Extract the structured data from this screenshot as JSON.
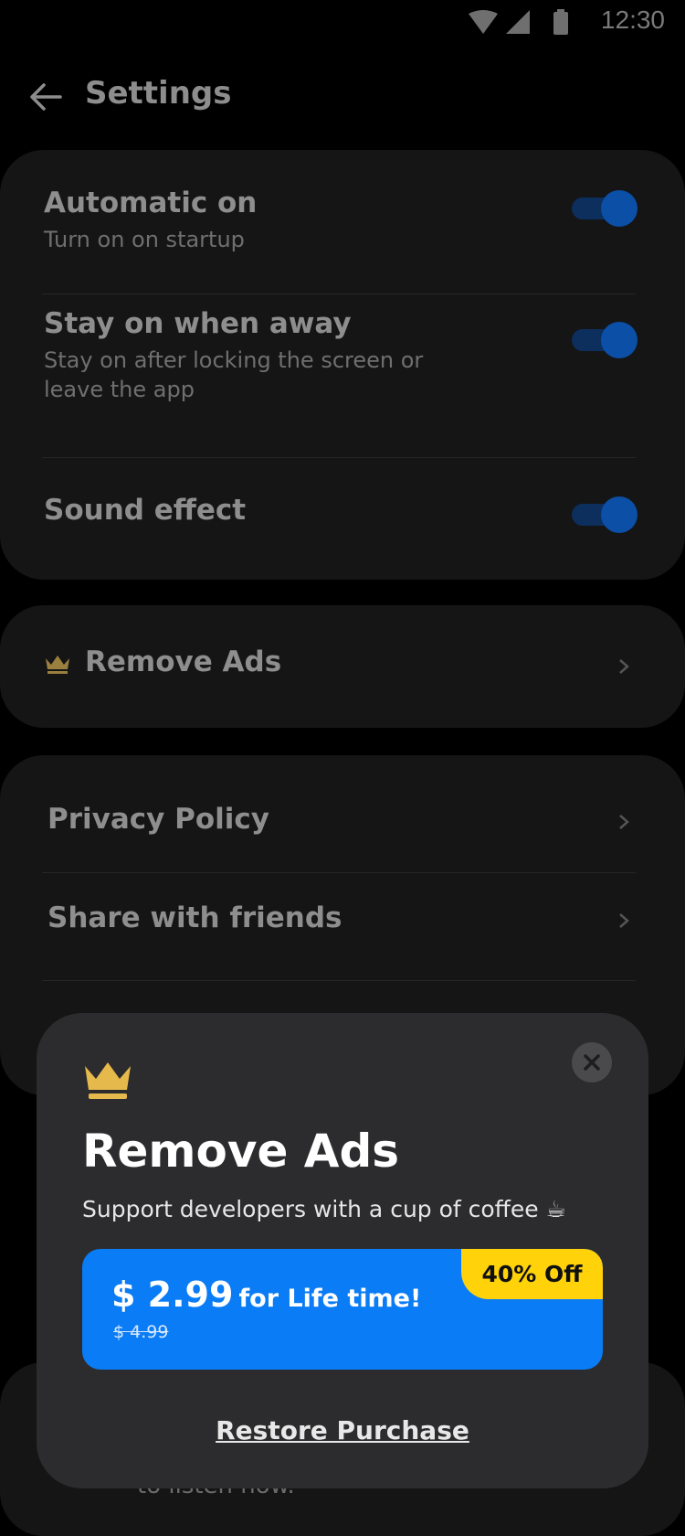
{
  "status_bar": {
    "time": "12:30"
  },
  "appbar": {
    "title": "Settings"
  },
  "settings": [
    {
      "title": "Automatic on",
      "subtitle": "Turn on on startup",
      "enabled": true
    },
    {
      "title": "Stay on when away",
      "subtitle": "Stay on after locking the screen or leave the app",
      "enabled": true
    },
    {
      "title": "Sound effect",
      "subtitle": "",
      "enabled": true
    }
  ],
  "remove_ads_row": {
    "label": "Remove Ads"
  },
  "links": [
    {
      "label": "Privacy Policy"
    },
    {
      "label": "Share with friends"
    }
  ],
  "background_snippet": "to listen now.",
  "modal": {
    "title": "Remove Ads",
    "subtitle": "Support developers with a cup of coffee ☕",
    "price": "$ 2.99",
    "price_suffix": "for Life time!",
    "old_price": "$ 4.99",
    "discount": "40% Off",
    "restore_label": "Restore Purchase"
  },
  "colors": {
    "accent": "#0a7cf5",
    "badge": "#ffd20a",
    "crown": "#e6b94c",
    "toggle_on": "#0b4fa6"
  },
  "icons": {
    "back": "arrow-left-icon",
    "crown": "crown-icon",
    "chevron": "chevron-right-icon",
    "close": "close-icon"
  }
}
